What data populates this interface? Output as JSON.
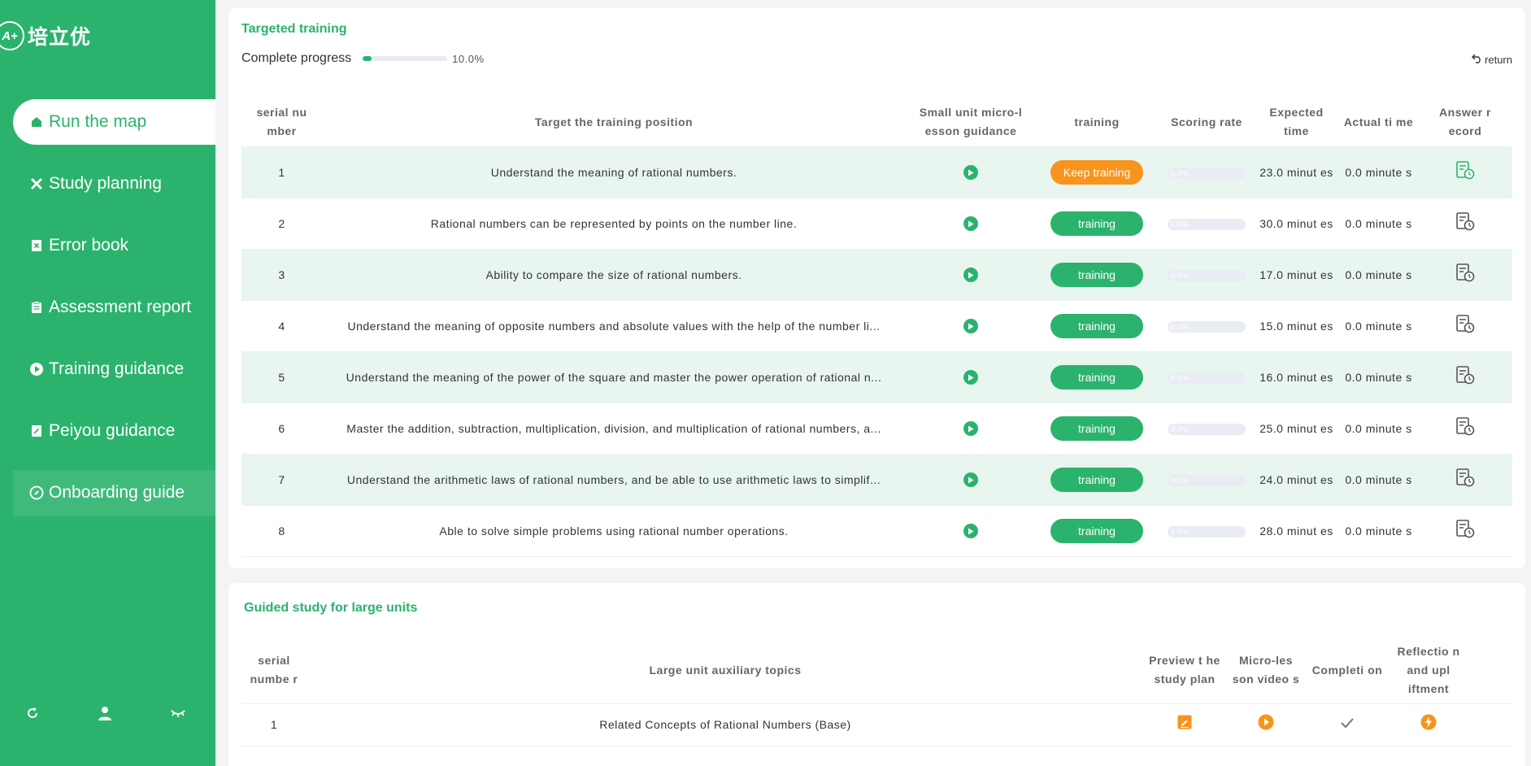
{
  "brand": {
    "mark": "A+",
    "name": "培立优"
  },
  "sidebar": {
    "items": [
      {
        "label": "Run the map",
        "icon": "home-icon"
      },
      {
        "label": "Study planning",
        "icon": "tools-icon"
      },
      {
        "label": "Error book",
        "icon": "error-book-icon"
      },
      {
        "label": "Assessment report",
        "icon": "clipboard-icon"
      },
      {
        "label": "Training guidance",
        "icon": "play-circle-icon"
      },
      {
        "label": "Peiyou guidance",
        "icon": "edit-note-icon"
      },
      {
        "label": "Onboarding guide",
        "icon": "compass-icon"
      }
    ],
    "active_index": 0,
    "bottom": [
      "refresh-icon",
      "user-icon",
      "eye-closed-icon"
    ]
  },
  "targeted": {
    "title": "Targeted training",
    "progress_label": "Complete progress",
    "progress_fraction": 0.1,
    "progress_text": "10.0%",
    "return_label": "return",
    "headers": {
      "sn": "serial nu mber",
      "pos": "Target the training position",
      "guid": "Small unit micro-l esson guidance",
      "train": "training",
      "score": "Scoring rate",
      "exp": "Expected time",
      "act": "Actual ti me",
      "rec": "Answer r ecord"
    },
    "rows": [
      {
        "sn": "1",
        "pos": "Understand the meaning of rational numbers.",
        "btn": "Keep training",
        "keep": true,
        "score": "0.0%",
        "exp": "23.0 minut es",
        "act": "0.0 minute s"
      },
      {
        "sn": "2",
        "pos": "Rational numbers can be represented by points on the number line.",
        "btn": "training",
        "keep": false,
        "score": "0.0%",
        "exp": "30.0 minut es",
        "act": "0.0 minute s"
      },
      {
        "sn": "3",
        "pos": "Ability to compare the size of rational numbers.",
        "btn": "training",
        "keep": false,
        "score": "0.0%",
        "exp": "17.0 minut es",
        "act": "0.0 minute s"
      },
      {
        "sn": "4",
        "pos": "Understand the meaning of opposite numbers and absolute values with the help of the number li...",
        "btn": "training",
        "keep": false,
        "score": "0.0%",
        "exp": "15.0 minut es",
        "act": "0.0 minute s"
      },
      {
        "sn": "5",
        "pos": "Understand the meaning of the power of the square and master the power operation of rational n...",
        "btn": "training",
        "keep": false,
        "score": "0.0%",
        "exp": "16.0 minut es",
        "act": "0.0 minute s"
      },
      {
        "sn": "6",
        "pos": "Master the addition, subtraction, multiplication, division, and multiplication of rational numbers, a...",
        "btn": "training",
        "keep": false,
        "score": "0.0%",
        "exp": "25.0 minut es",
        "act": "0.0 minute s"
      },
      {
        "sn": "7",
        "pos": "Understand the arithmetic laws of rational numbers, and be able to use arithmetic laws to simplif...",
        "btn": "training",
        "keep": false,
        "score": "0.0%",
        "exp": "24.0 minut es",
        "act": "0.0 minute s"
      },
      {
        "sn": "8",
        "pos": "Able to solve simple problems using rational number operations.",
        "btn": "training",
        "keep": false,
        "score": "0.0%",
        "exp": "28.0 minut es",
        "act": "0.0 minute s"
      }
    ]
  },
  "guided": {
    "title": "Guided study for large units",
    "headers": {
      "sn": "serial numbe r",
      "topic": "Large unit auxiliary topics",
      "prev": "Preview t he study plan",
      "vid": "Micro-les son video s",
      "comp": "Completi on",
      "ref": "Reflectio n and upl iftment"
    },
    "rows": [
      {
        "sn": "1",
        "topic": "Related Concepts of Rational Numbers (Base)"
      }
    ]
  },
  "colors": {
    "accent": "#2bb36d",
    "orange": "#f7941d",
    "stripe": "#e8f6ef"
  }
}
